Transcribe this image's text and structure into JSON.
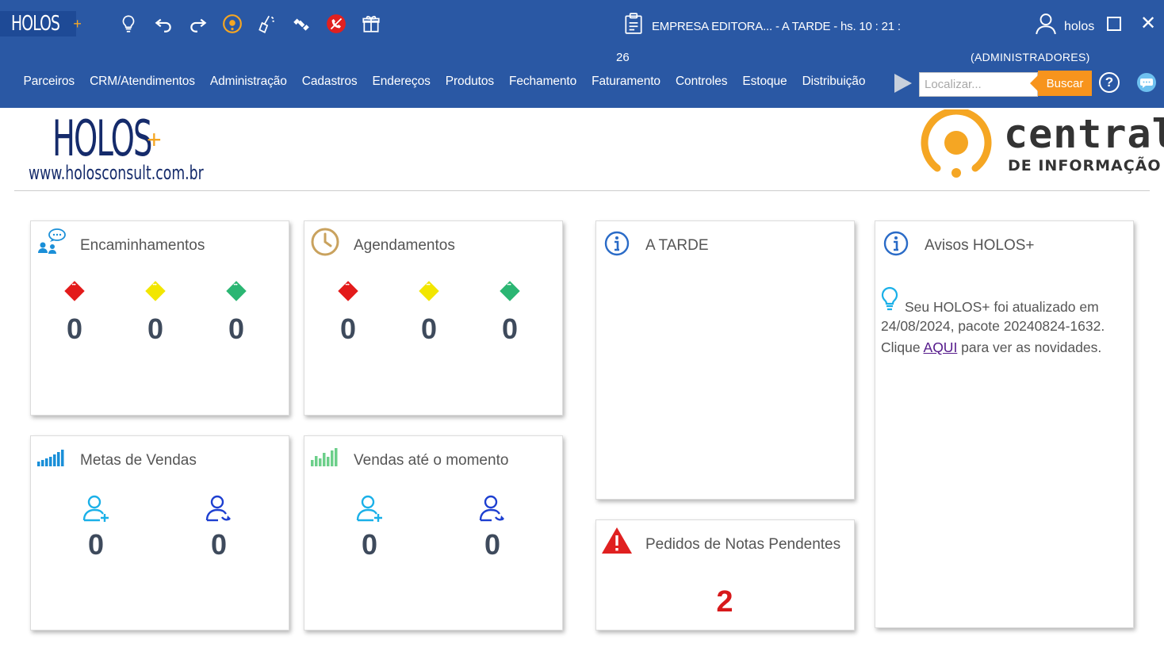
{
  "app": {
    "logo_text": "HOLOS",
    "logo_plus": "+",
    "window_title": "EMPRESA EDITORA... - A TARDE - hs. 10 : 21 :",
    "window_title_line2": "26",
    "user_name": "holos",
    "user_role": "(ADMINISTRADORES)"
  },
  "menu": {
    "items": [
      "Parceiros",
      "CRM/Atendimentos",
      "Administração",
      "Cadastros",
      "Endereços",
      "Produtos",
      "Fechamento",
      "Faturamento",
      "Controles",
      "Estoque",
      "Distribuição"
    ]
  },
  "search": {
    "placeholder": "Localizar...",
    "button_label": "Buscar"
  },
  "help": {
    "label": "?"
  },
  "brand": {
    "name": "HOLOS",
    "plus": "+",
    "url": "www.holosconsult.com.br",
    "central_title": "central",
    "central_subtitle": "DE INFORMAÇÃO"
  },
  "cards": {
    "encaminhamentos": {
      "title": "Encaminhamentos",
      "red": "0",
      "yellow": "0",
      "green": "0"
    },
    "agendamentos": {
      "title": "Agendamentos",
      "red": "0",
      "yellow": "0",
      "green": "0"
    },
    "metas": {
      "title": "Metas de Vendas",
      "new": "0",
      "assigned": "0"
    },
    "vendas": {
      "title": "Vendas até o momento",
      "new": "0",
      "assigned": "0"
    },
    "a_tarde": {
      "title": "A TARDE"
    },
    "avisos": {
      "title": "Avisos HOLOS+",
      "line1": "Seu HOLOS+ foi atualizado em 24/08/2024, pacote 20240824-1632.",
      "line2_pre": "Clique ",
      "line2_link": "AQUI",
      "line2_post": " para ver as novidades."
    },
    "pedidos": {
      "title": "Pedidos de Notas Pendentes",
      "count": "2"
    }
  },
  "colors": {
    "header_bg": "#2a58a4",
    "accent_orange": "#f7941d",
    "status_red": "#e31b1b",
    "status_yellow": "#f2e600",
    "status_green": "#2bb673",
    "count_text": "#3e4a5c",
    "alert_red": "#d7191b"
  }
}
